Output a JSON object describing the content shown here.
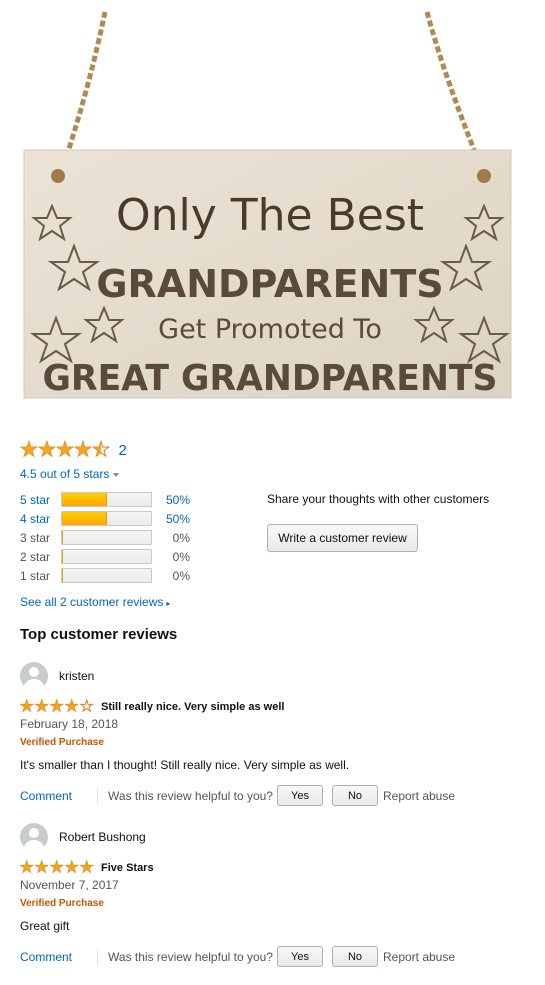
{
  "product": {
    "image_alt": "Wooden hanging plaque",
    "sign_text": {
      "line1": "Only The Best",
      "line2": "GRANDPARENTS",
      "line3": "Get Promoted To",
      "line4": "GREAT GRANDPARENTS"
    }
  },
  "rating_summary": {
    "stars": 4.5,
    "review_count": "2",
    "out_of_text": "4.5 out of 5 stars",
    "histogram": [
      {
        "label": "5 star",
        "percent": 50,
        "percent_text": "50%"
      },
      {
        "label": "4 star",
        "percent": 50,
        "percent_text": "50%"
      },
      {
        "label": "3 star",
        "percent": 0,
        "percent_text": "0%"
      },
      {
        "label": "2 star",
        "percent": 0,
        "percent_text": "0%"
      },
      {
        "label": "1 star",
        "percent": 0,
        "percent_text": "0%"
      }
    ],
    "share_text": "Share your thoughts with other customers",
    "write_review_label": "Write a customer review",
    "see_all_label": "See all 2 customer reviews"
  },
  "top_reviews": {
    "heading": "Top customer reviews",
    "reviews": [
      {
        "author": "kristen",
        "rating": 4,
        "title": "Still really nice. Very simple as well",
        "date": "February 18, 2018",
        "badge": "Verified Purchase",
        "body": "It's smaller than I thought! Still really nice. Very simple as well.",
        "comment_label": "Comment",
        "helpful_question": "Was this review helpful to you?",
        "yes_label": "Yes",
        "no_label": "No",
        "report_label": "Report abuse"
      },
      {
        "author": "Robert Bushong",
        "rating": 5,
        "title": "Five Stars",
        "date": "November 7, 2017",
        "badge": "Verified Purchase",
        "body": "Great gift",
        "comment_label": "Comment",
        "helpful_question": "Was this review helpful to you?",
        "yes_label": "Yes",
        "no_label": "No",
        "report_label": "Report abuse"
      }
    ]
  },
  "colors": {
    "link": "#0066c0",
    "star": "#f0a71b",
    "verified": "#c45500",
    "bar_fill": "#ffa700"
  }
}
